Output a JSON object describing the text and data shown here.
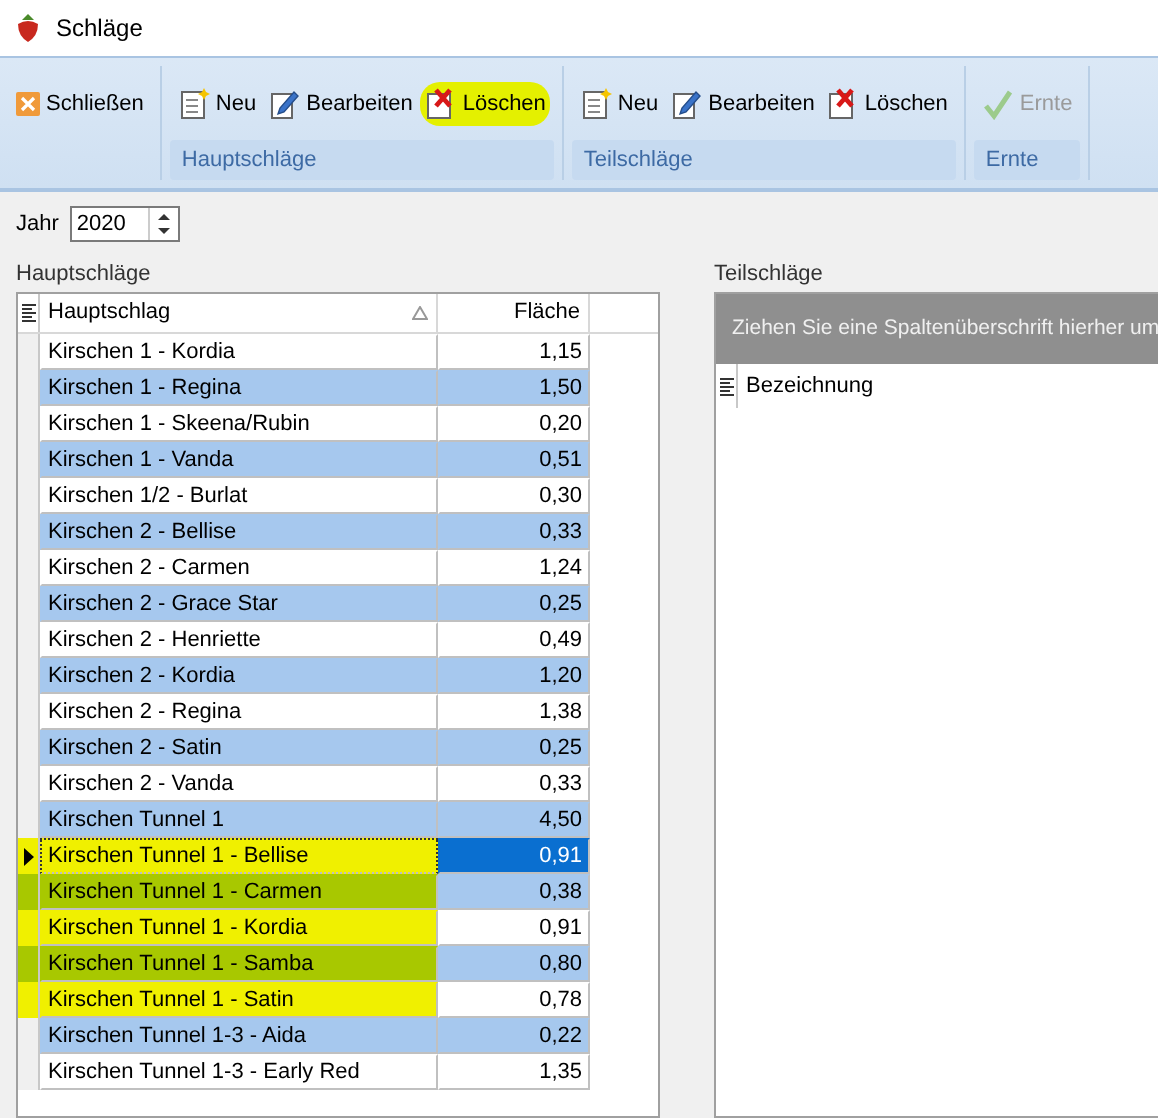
{
  "window": {
    "title": "Schläge"
  },
  "ribbon": {
    "close_button": {
      "label": "Schließen"
    },
    "groups": [
      {
        "label": "Hauptschläge",
        "buttons": [
          {
            "kind": "new",
            "label": "Neu",
            "disabled": false,
            "highlighted": false
          },
          {
            "kind": "edit",
            "label": "Bearbeiten",
            "disabled": false,
            "highlighted": false
          },
          {
            "kind": "delete",
            "label": "Löschen",
            "disabled": false,
            "highlighted": true
          }
        ]
      },
      {
        "label": "Teilschläge",
        "buttons": [
          {
            "kind": "new",
            "label": "Neu",
            "disabled": false,
            "highlighted": false
          },
          {
            "kind": "edit",
            "label": "Bearbeiten",
            "disabled": false,
            "highlighted": false
          },
          {
            "kind": "delete",
            "label": "Löschen",
            "disabled": false,
            "highlighted": false
          }
        ]
      },
      {
        "label": "Ernte",
        "buttons": [
          {
            "kind": "check",
            "label": "Ernte",
            "disabled": true,
            "highlighted": false
          }
        ]
      }
    ]
  },
  "year": {
    "label": "Jahr",
    "value": "2020"
  },
  "main_panel": {
    "title": "Hauptschläge",
    "columns": [
      "Hauptschlag",
      "Fläche"
    ],
    "rows": [
      {
        "name": "Kirschen 1 - Kordia",
        "area": "1,15",
        "selected": false,
        "highlighted": false
      },
      {
        "name": "Kirschen 1 - Regina",
        "area": "1,50",
        "selected": false,
        "highlighted": false
      },
      {
        "name": "Kirschen 1 - Skeena/Rubin",
        "area": "0,20",
        "selected": false,
        "highlighted": false
      },
      {
        "name": "Kirschen 1 - Vanda",
        "area": "0,51",
        "selected": false,
        "highlighted": false
      },
      {
        "name": "Kirschen 1/2 - Burlat",
        "area": "0,30",
        "selected": false,
        "highlighted": false
      },
      {
        "name": "Kirschen 2 - Bellise",
        "area": "0,33",
        "selected": false,
        "highlighted": false
      },
      {
        "name": "Kirschen 2 - Carmen",
        "area": "1,24",
        "selected": false,
        "highlighted": false
      },
      {
        "name": "Kirschen 2 - Grace Star",
        "area": "0,25",
        "selected": false,
        "highlighted": false
      },
      {
        "name": "Kirschen 2 - Henriette",
        "area": "0,49",
        "selected": false,
        "highlighted": false
      },
      {
        "name": "Kirschen 2 - Kordia",
        "area": "1,20",
        "selected": false,
        "highlighted": false
      },
      {
        "name": "Kirschen 2 - Regina",
        "area": "1,38",
        "selected": false,
        "highlighted": false
      },
      {
        "name": "Kirschen 2 - Satin",
        "area": "0,25",
        "selected": false,
        "highlighted": false
      },
      {
        "name": "Kirschen 2 - Vanda",
        "area": "0,33",
        "selected": false,
        "highlighted": false
      },
      {
        "name": "Kirschen Tunnel 1",
        "area": "4,50",
        "selected": false,
        "highlighted": false
      },
      {
        "name": "Kirschen Tunnel 1 - Bellise",
        "area": "0,91",
        "selected": true,
        "highlighted": true
      },
      {
        "name": "Kirschen Tunnel 1 - Carmen",
        "area": "0,38",
        "selected": false,
        "highlighted": true
      },
      {
        "name": "Kirschen Tunnel 1 - Kordia",
        "area": "0,91",
        "selected": false,
        "highlighted": true
      },
      {
        "name": "Kirschen Tunnel 1 - Samba",
        "area": "0,80",
        "selected": false,
        "highlighted": true
      },
      {
        "name": "Kirschen Tunnel 1 - Satin",
        "area": "0,78",
        "selected": false,
        "highlighted": true
      },
      {
        "name": "Kirschen Tunnel 1-3 - Aida",
        "area": "0,22",
        "selected": false,
        "highlighted": false
      },
      {
        "name": "Kirschen Tunnel 1-3 - Early Red",
        "area": "1,35",
        "selected": false,
        "highlighted": false
      }
    ]
  },
  "sub_panel": {
    "title": "Teilschläge",
    "group_hint": "Ziehen Sie eine Spaltenüberschrift hierher um",
    "columns": [
      "Bezeichnung"
    ]
  }
}
